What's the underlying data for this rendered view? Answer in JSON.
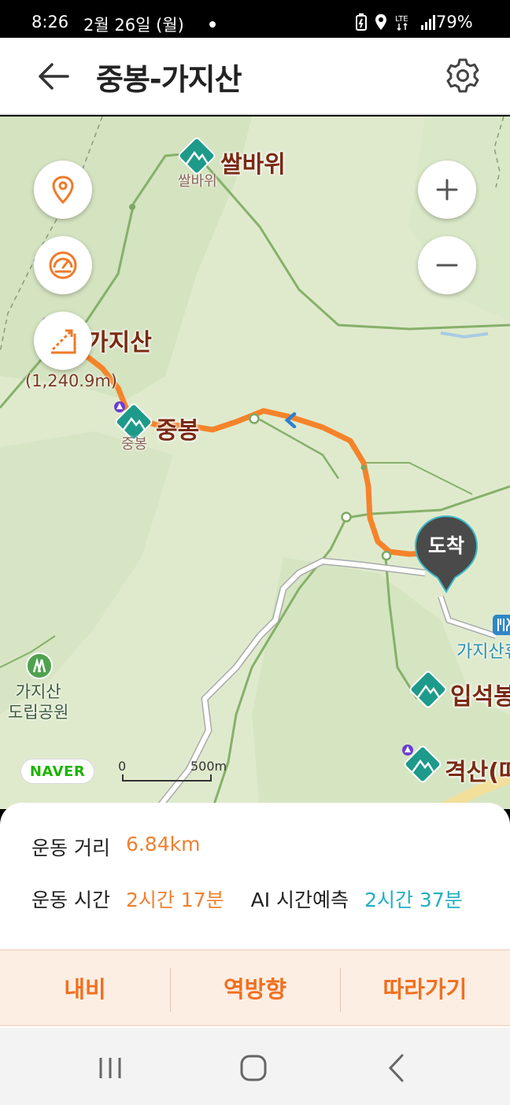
{
  "status_bar": {
    "time": "8:26",
    "date": "2월 26일 (월)",
    "battery": "79%"
  },
  "header": {
    "title": "중봉-가지산",
    "back_icon": "arrow-left-icon",
    "settings_icon": "gear-icon"
  },
  "map": {
    "peaks": {
      "ssalbawi": "쌀바위",
      "ssalbawi_sub": "쌀바위",
      "gajisan": "가지산",
      "gajisan_elev": "(1,240.9m)",
      "jungbong": "중봉",
      "jungbong_sub": "중봉",
      "ipseokbong": "입석봉",
      "gyeoksan": "격산(따"
    },
    "park_label_1": "가지산",
    "park_label_2": "도립공원",
    "poi_label": "가지산휴",
    "destination": "도착",
    "naver": "NAVER",
    "scale_zero": "0",
    "scale_dist": "500m",
    "colors": {
      "route": "#f5832a",
      "peak_marker": "#1e9a8a",
      "trail": "#86b06a"
    }
  },
  "stats": {
    "distance_label": "운동 거리",
    "distance_value": "6.84km",
    "time_label": "운동 시간",
    "time_value": "2시간 17분",
    "ai_label": "AI 시간예측",
    "ai_value": "2시간 37분"
  },
  "actions": {
    "navigation": "내비",
    "reverse": "역방향",
    "follow": "따라가기"
  }
}
